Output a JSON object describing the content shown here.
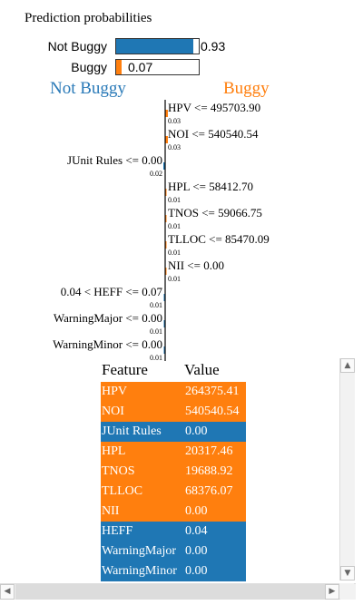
{
  "title": "Prediction probabilities",
  "probabilities": [
    {
      "label": "Not Buggy",
      "value": 0.93,
      "value_text": "0.93",
      "color": "#1f77b4"
    },
    {
      "label": "Buggy",
      "value": 0.07,
      "value_text": "0.07",
      "color": "#ff7f0e"
    }
  ],
  "class_left": "Not Buggy",
  "class_right": "Buggy",
  "chart_data": {
    "type": "bar",
    "orientation": "horizontal",
    "categories": [
      "HPV <= 495703.90",
      "NOI <= 540540.54",
      "JUnit Rules <= 0.00",
      "HPL <= 58412.70",
      "TNOS <= 59066.75",
      "TLLOC <= 85470.09",
      "NII <= 0.00",
      "0.04 < HEFF <= 0.07",
      "WarningMajor <= 0.00",
      "WarningMinor <= 0.00"
    ],
    "values": [
      0.03,
      0.03,
      -0.02,
      0.01,
      0.01,
      0.01,
      0.01,
      -0.01,
      -0.01,
      -0.01
    ],
    "value_labels": [
      "0.03",
      "0.03",
      "0.02",
      "0.01",
      "0.01",
      "0.01",
      "0.01",
      "0.01",
      "0.01",
      "0.01"
    ],
    "colors": {
      "positive": "#ff7f0e",
      "negative": "#1f77b4"
    }
  },
  "table": {
    "header_feature": "Feature",
    "header_value": "Value",
    "rows": [
      {
        "feature": "HPV",
        "value": "264375.41",
        "color": "#ff7f0e"
      },
      {
        "feature": "NOI",
        "value": "540540.54",
        "color": "#ff7f0e"
      },
      {
        "feature": "JUnit Rules",
        "value": "0.00",
        "color": "#1f77b4"
      },
      {
        "feature": "HPL",
        "value": "20317.46",
        "color": "#ff7f0e"
      },
      {
        "feature": "TNOS",
        "value": "19688.92",
        "color": "#ff7f0e"
      },
      {
        "feature": "TLLOC",
        "value": "68376.07",
        "color": "#ff7f0e"
      },
      {
        "feature": "NII",
        "value": "0.00",
        "color": "#ff7f0e"
      },
      {
        "feature": "HEFF",
        "value": "0.04",
        "color": "#1f77b4"
      },
      {
        "feature": "WarningMajor",
        "value": "0.00",
        "color": "#1f77b4"
      },
      {
        "feature": "WarningMinor",
        "value": "0.00",
        "color": "#1f77b4"
      }
    ]
  },
  "scrollbar_icons": {
    "up": "triangle-up-icon",
    "down": "triangle-down-icon",
    "left": "triangle-left-icon",
    "right": "triangle-right-icon"
  }
}
